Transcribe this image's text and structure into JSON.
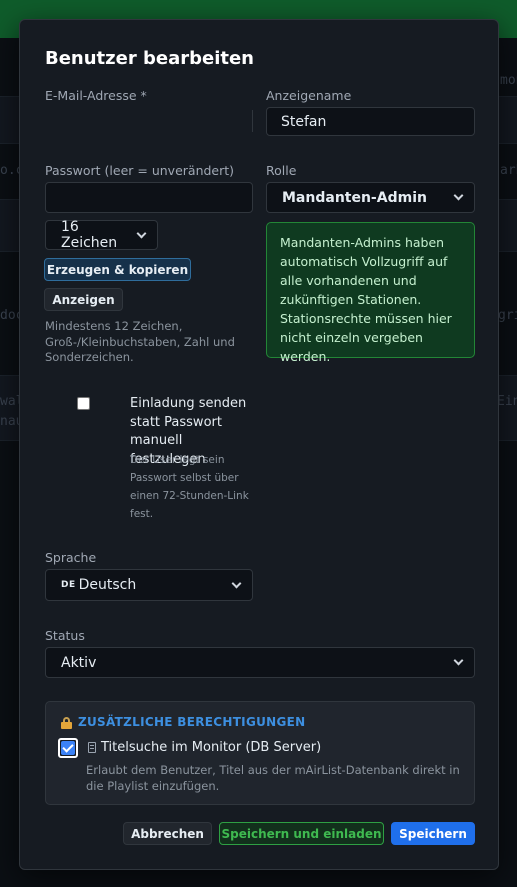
{
  "colors": {
    "modal_bg": "#161b22",
    "accent_blue": "#1f6feb",
    "success_green": "#238636",
    "info_box_bg": "#0f3a20",
    "heading_blue": "#3d8fe0"
  },
  "background": {
    "fragments": [
      "mon",
      "o.c",
      "arb",
      "doc",
      "grif",
      "walt",
      "nau",
      "Einç"
    ]
  },
  "modal": {
    "title": "Benutzer bearbeiten",
    "email": {
      "label": "E-Mail-Adresse *",
      "value": ""
    },
    "display_name": {
      "label": "Anzeigename",
      "value": "Stefan"
    },
    "password": {
      "label": "Passwort (leer = unverändert)",
      "value": "",
      "length_select": "16 Zeichen",
      "generate_label": "Erzeugen & kopieren",
      "show_label": "Anzeigen",
      "hint": "Mindestens 12 Zeichen, Groß-/Kleinbuchstaben, Zahl und Sonderzeichen."
    },
    "role": {
      "label": "Rolle",
      "value": "Mandanten-Admin",
      "info": "Mandanten-Admins haben automatisch Vollzugriff auf alle vorhandenen und zukünftigen Stationen. Stationsrechte müssen hier nicht einzeln vergeben werden."
    },
    "invite": {
      "checked": false,
      "label": "Einladung senden statt Passwort manuell festzulegen",
      "hint": "Der User legt sein Passwort selbst über einen 72-Stunden-Link fest."
    },
    "language": {
      "label": "Sprache",
      "flag": "DE",
      "value": "Deutsch"
    },
    "status": {
      "label": "Status",
      "value": "Aktiv"
    },
    "permissions": {
      "heading": "ZUSÄTZLICHE BERECHTIGUNGEN",
      "heading_icon": "lock-icon",
      "item_icon": "database-icon",
      "item_label": "Titelsuche im Monitor (DB Server)",
      "item_checked": true,
      "item_desc": "Erlaubt dem Benutzer, Titel aus der mAirList-Datenbank direkt in die Playlist einzufügen."
    },
    "buttons": {
      "cancel": "Abbrechen",
      "save_invite": "Speichern und einladen",
      "save": "Speichern"
    }
  }
}
